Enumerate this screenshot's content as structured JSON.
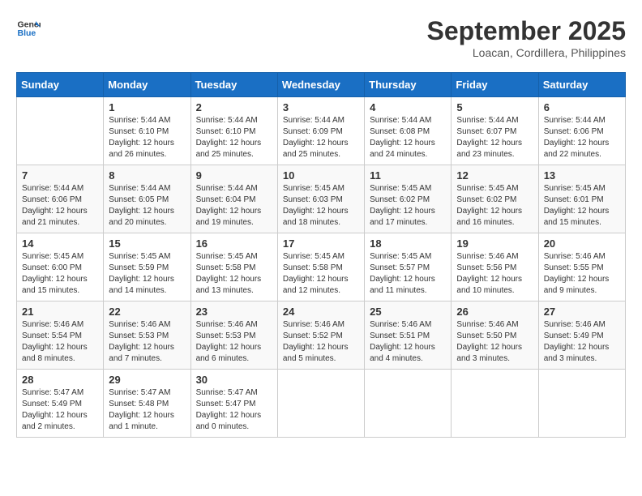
{
  "header": {
    "logo_line1": "General",
    "logo_line2": "Blue",
    "month": "September 2025",
    "location": "Loacan, Cordillera, Philippines"
  },
  "weekdays": [
    "Sunday",
    "Monday",
    "Tuesday",
    "Wednesday",
    "Thursday",
    "Friday",
    "Saturday"
  ],
  "weeks": [
    [
      {
        "day": "",
        "info": ""
      },
      {
        "day": "1",
        "info": "Sunrise: 5:44 AM\nSunset: 6:10 PM\nDaylight: 12 hours\nand 26 minutes."
      },
      {
        "day": "2",
        "info": "Sunrise: 5:44 AM\nSunset: 6:10 PM\nDaylight: 12 hours\nand 25 minutes."
      },
      {
        "day": "3",
        "info": "Sunrise: 5:44 AM\nSunset: 6:09 PM\nDaylight: 12 hours\nand 25 minutes."
      },
      {
        "day": "4",
        "info": "Sunrise: 5:44 AM\nSunset: 6:08 PM\nDaylight: 12 hours\nand 24 minutes."
      },
      {
        "day": "5",
        "info": "Sunrise: 5:44 AM\nSunset: 6:07 PM\nDaylight: 12 hours\nand 23 minutes."
      },
      {
        "day": "6",
        "info": "Sunrise: 5:44 AM\nSunset: 6:06 PM\nDaylight: 12 hours\nand 22 minutes."
      }
    ],
    [
      {
        "day": "7",
        "info": "Sunrise: 5:44 AM\nSunset: 6:06 PM\nDaylight: 12 hours\nand 21 minutes."
      },
      {
        "day": "8",
        "info": "Sunrise: 5:44 AM\nSunset: 6:05 PM\nDaylight: 12 hours\nand 20 minutes."
      },
      {
        "day": "9",
        "info": "Sunrise: 5:44 AM\nSunset: 6:04 PM\nDaylight: 12 hours\nand 19 minutes."
      },
      {
        "day": "10",
        "info": "Sunrise: 5:45 AM\nSunset: 6:03 PM\nDaylight: 12 hours\nand 18 minutes."
      },
      {
        "day": "11",
        "info": "Sunrise: 5:45 AM\nSunset: 6:02 PM\nDaylight: 12 hours\nand 17 minutes."
      },
      {
        "day": "12",
        "info": "Sunrise: 5:45 AM\nSunset: 6:02 PM\nDaylight: 12 hours\nand 16 minutes."
      },
      {
        "day": "13",
        "info": "Sunrise: 5:45 AM\nSunset: 6:01 PM\nDaylight: 12 hours\nand 15 minutes."
      }
    ],
    [
      {
        "day": "14",
        "info": "Sunrise: 5:45 AM\nSunset: 6:00 PM\nDaylight: 12 hours\nand 15 minutes."
      },
      {
        "day": "15",
        "info": "Sunrise: 5:45 AM\nSunset: 5:59 PM\nDaylight: 12 hours\nand 14 minutes."
      },
      {
        "day": "16",
        "info": "Sunrise: 5:45 AM\nSunset: 5:58 PM\nDaylight: 12 hours\nand 13 minutes."
      },
      {
        "day": "17",
        "info": "Sunrise: 5:45 AM\nSunset: 5:58 PM\nDaylight: 12 hours\nand 12 minutes."
      },
      {
        "day": "18",
        "info": "Sunrise: 5:45 AM\nSunset: 5:57 PM\nDaylight: 12 hours\nand 11 minutes."
      },
      {
        "day": "19",
        "info": "Sunrise: 5:46 AM\nSunset: 5:56 PM\nDaylight: 12 hours\nand 10 minutes."
      },
      {
        "day": "20",
        "info": "Sunrise: 5:46 AM\nSunset: 5:55 PM\nDaylight: 12 hours\nand 9 minutes."
      }
    ],
    [
      {
        "day": "21",
        "info": "Sunrise: 5:46 AM\nSunset: 5:54 PM\nDaylight: 12 hours\nand 8 minutes."
      },
      {
        "day": "22",
        "info": "Sunrise: 5:46 AM\nSunset: 5:53 PM\nDaylight: 12 hours\nand 7 minutes."
      },
      {
        "day": "23",
        "info": "Sunrise: 5:46 AM\nSunset: 5:53 PM\nDaylight: 12 hours\nand 6 minutes."
      },
      {
        "day": "24",
        "info": "Sunrise: 5:46 AM\nSunset: 5:52 PM\nDaylight: 12 hours\nand 5 minutes."
      },
      {
        "day": "25",
        "info": "Sunrise: 5:46 AM\nSunset: 5:51 PM\nDaylight: 12 hours\nand 4 minutes."
      },
      {
        "day": "26",
        "info": "Sunrise: 5:46 AM\nSunset: 5:50 PM\nDaylight: 12 hours\nand 3 minutes."
      },
      {
        "day": "27",
        "info": "Sunrise: 5:46 AM\nSunset: 5:49 PM\nDaylight: 12 hours\nand 3 minutes."
      }
    ],
    [
      {
        "day": "28",
        "info": "Sunrise: 5:47 AM\nSunset: 5:49 PM\nDaylight: 12 hours\nand 2 minutes."
      },
      {
        "day": "29",
        "info": "Sunrise: 5:47 AM\nSunset: 5:48 PM\nDaylight: 12 hours\nand 1 minute."
      },
      {
        "day": "30",
        "info": "Sunrise: 5:47 AM\nSunset: 5:47 PM\nDaylight: 12 hours\nand 0 minutes."
      },
      {
        "day": "",
        "info": ""
      },
      {
        "day": "",
        "info": ""
      },
      {
        "day": "",
        "info": ""
      },
      {
        "day": "",
        "info": ""
      }
    ]
  ]
}
